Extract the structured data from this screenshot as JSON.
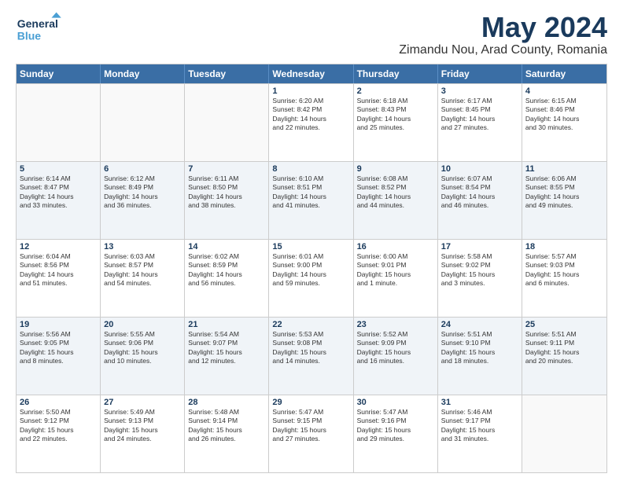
{
  "header": {
    "logo_line1": "General",
    "logo_line2": "Blue",
    "month": "May 2024",
    "location": "Zimandu Nou, Arad County, Romania"
  },
  "days": [
    "Sunday",
    "Monday",
    "Tuesday",
    "Wednesday",
    "Thursday",
    "Friday",
    "Saturday"
  ],
  "weeks": [
    [
      {
        "day": "",
        "info": ""
      },
      {
        "day": "",
        "info": ""
      },
      {
        "day": "",
        "info": ""
      },
      {
        "day": "1",
        "info": "Sunrise: 6:20 AM\nSunset: 8:42 PM\nDaylight: 14 hours\nand 22 minutes."
      },
      {
        "day": "2",
        "info": "Sunrise: 6:18 AM\nSunset: 8:43 PM\nDaylight: 14 hours\nand 25 minutes."
      },
      {
        "day": "3",
        "info": "Sunrise: 6:17 AM\nSunset: 8:45 PM\nDaylight: 14 hours\nand 27 minutes."
      },
      {
        "day": "4",
        "info": "Sunrise: 6:15 AM\nSunset: 8:46 PM\nDaylight: 14 hours\nand 30 minutes."
      }
    ],
    [
      {
        "day": "5",
        "info": "Sunrise: 6:14 AM\nSunset: 8:47 PM\nDaylight: 14 hours\nand 33 minutes."
      },
      {
        "day": "6",
        "info": "Sunrise: 6:12 AM\nSunset: 8:49 PM\nDaylight: 14 hours\nand 36 minutes."
      },
      {
        "day": "7",
        "info": "Sunrise: 6:11 AM\nSunset: 8:50 PM\nDaylight: 14 hours\nand 38 minutes."
      },
      {
        "day": "8",
        "info": "Sunrise: 6:10 AM\nSunset: 8:51 PM\nDaylight: 14 hours\nand 41 minutes."
      },
      {
        "day": "9",
        "info": "Sunrise: 6:08 AM\nSunset: 8:52 PM\nDaylight: 14 hours\nand 44 minutes."
      },
      {
        "day": "10",
        "info": "Sunrise: 6:07 AM\nSunset: 8:54 PM\nDaylight: 14 hours\nand 46 minutes."
      },
      {
        "day": "11",
        "info": "Sunrise: 6:06 AM\nSunset: 8:55 PM\nDaylight: 14 hours\nand 49 minutes."
      }
    ],
    [
      {
        "day": "12",
        "info": "Sunrise: 6:04 AM\nSunset: 8:56 PM\nDaylight: 14 hours\nand 51 minutes."
      },
      {
        "day": "13",
        "info": "Sunrise: 6:03 AM\nSunset: 8:57 PM\nDaylight: 14 hours\nand 54 minutes."
      },
      {
        "day": "14",
        "info": "Sunrise: 6:02 AM\nSunset: 8:59 PM\nDaylight: 14 hours\nand 56 minutes."
      },
      {
        "day": "15",
        "info": "Sunrise: 6:01 AM\nSunset: 9:00 PM\nDaylight: 14 hours\nand 59 minutes."
      },
      {
        "day": "16",
        "info": "Sunrise: 6:00 AM\nSunset: 9:01 PM\nDaylight: 15 hours\nand 1 minute."
      },
      {
        "day": "17",
        "info": "Sunrise: 5:58 AM\nSunset: 9:02 PM\nDaylight: 15 hours\nand 3 minutes."
      },
      {
        "day": "18",
        "info": "Sunrise: 5:57 AM\nSunset: 9:03 PM\nDaylight: 15 hours\nand 6 minutes."
      }
    ],
    [
      {
        "day": "19",
        "info": "Sunrise: 5:56 AM\nSunset: 9:05 PM\nDaylight: 15 hours\nand 8 minutes."
      },
      {
        "day": "20",
        "info": "Sunrise: 5:55 AM\nSunset: 9:06 PM\nDaylight: 15 hours\nand 10 minutes."
      },
      {
        "day": "21",
        "info": "Sunrise: 5:54 AM\nSunset: 9:07 PM\nDaylight: 15 hours\nand 12 minutes."
      },
      {
        "day": "22",
        "info": "Sunrise: 5:53 AM\nSunset: 9:08 PM\nDaylight: 15 hours\nand 14 minutes."
      },
      {
        "day": "23",
        "info": "Sunrise: 5:52 AM\nSunset: 9:09 PM\nDaylight: 15 hours\nand 16 minutes."
      },
      {
        "day": "24",
        "info": "Sunrise: 5:51 AM\nSunset: 9:10 PM\nDaylight: 15 hours\nand 18 minutes."
      },
      {
        "day": "25",
        "info": "Sunrise: 5:51 AM\nSunset: 9:11 PM\nDaylight: 15 hours\nand 20 minutes."
      }
    ],
    [
      {
        "day": "26",
        "info": "Sunrise: 5:50 AM\nSunset: 9:12 PM\nDaylight: 15 hours\nand 22 minutes."
      },
      {
        "day": "27",
        "info": "Sunrise: 5:49 AM\nSunset: 9:13 PM\nDaylight: 15 hours\nand 24 minutes."
      },
      {
        "day": "28",
        "info": "Sunrise: 5:48 AM\nSunset: 9:14 PM\nDaylight: 15 hours\nand 26 minutes."
      },
      {
        "day": "29",
        "info": "Sunrise: 5:47 AM\nSunset: 9:15 PM\nDaylight: 15 hours\nand 27 minutes."
      },
      {
        "day": "30",
        "info": "Sunrise: 5:47 AM\nSunset: 9:16 PM\nDaylight: 15 hours\nand 29 minutes."
      },
      {
        "day": "31",
        "info": "Sunrise: 5:46 AM\nSunset: 9:17 PM\nDaylight: 15 hours\nand 31 minutes."
      },
      {
        "day": "",
        "info": ""
      }
    ]
  ]
}
